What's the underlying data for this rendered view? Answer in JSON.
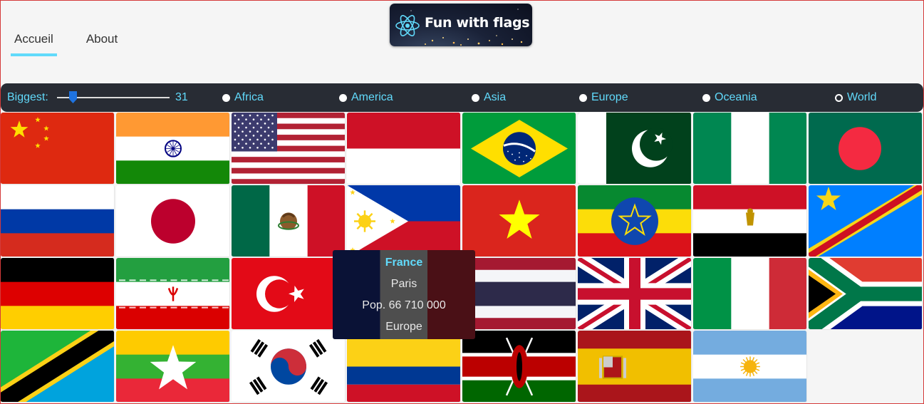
{
  "nav": {
    "tabs": [
      {
        "label": "Accueil",
        "active": true
      },
      {
        "label": "About",
        "active": false
      }
    ]
  },
  "logo": {
    "text": "Fun with flags"
  },
  "filter": {
    "biggest_label": "Biggest:",
    "slider_value": "31",
    "regions": [
      {
        "label": "Africa",
        "selected": false
      },
      {
        "label": "America",
        "selected": false
      },
      {
        "label": "Asia",
        "selected": false
      },
      {
        "label": "Europe",
        "selected": false
      },
      {
        "label": "Oceania",
        "selected": false
      },
      {
        "label": "World",
        "selected": true
      }
    ]
  },
  "flags": [
    "china",
    "india",
    "usa",
    "indonesia",
    "brazil",
    "pakistan",
    "nigeria",
    "bangladesh",
    "russia",
    "japan",
    "mexico",
    "philippines",
    "vietnam",
    "ethiopia",
    "egypt",
    "dr-congo",
    "germany",
    "iran",
    "turkey",
    "france",
    "thailand",
    "uk",
    "italy",
    "south-africa",
    "tanzania",
    "myanmar",
    "south-korea",
    "colombia",
    "kenya",
    "spain",
    "argentina"
  ],
  "tooltip": {
    "name": "France",
    "capital": "Paris",
    "population": "Pop. 66 710 000",
    "region": "Europe"
  }
}
